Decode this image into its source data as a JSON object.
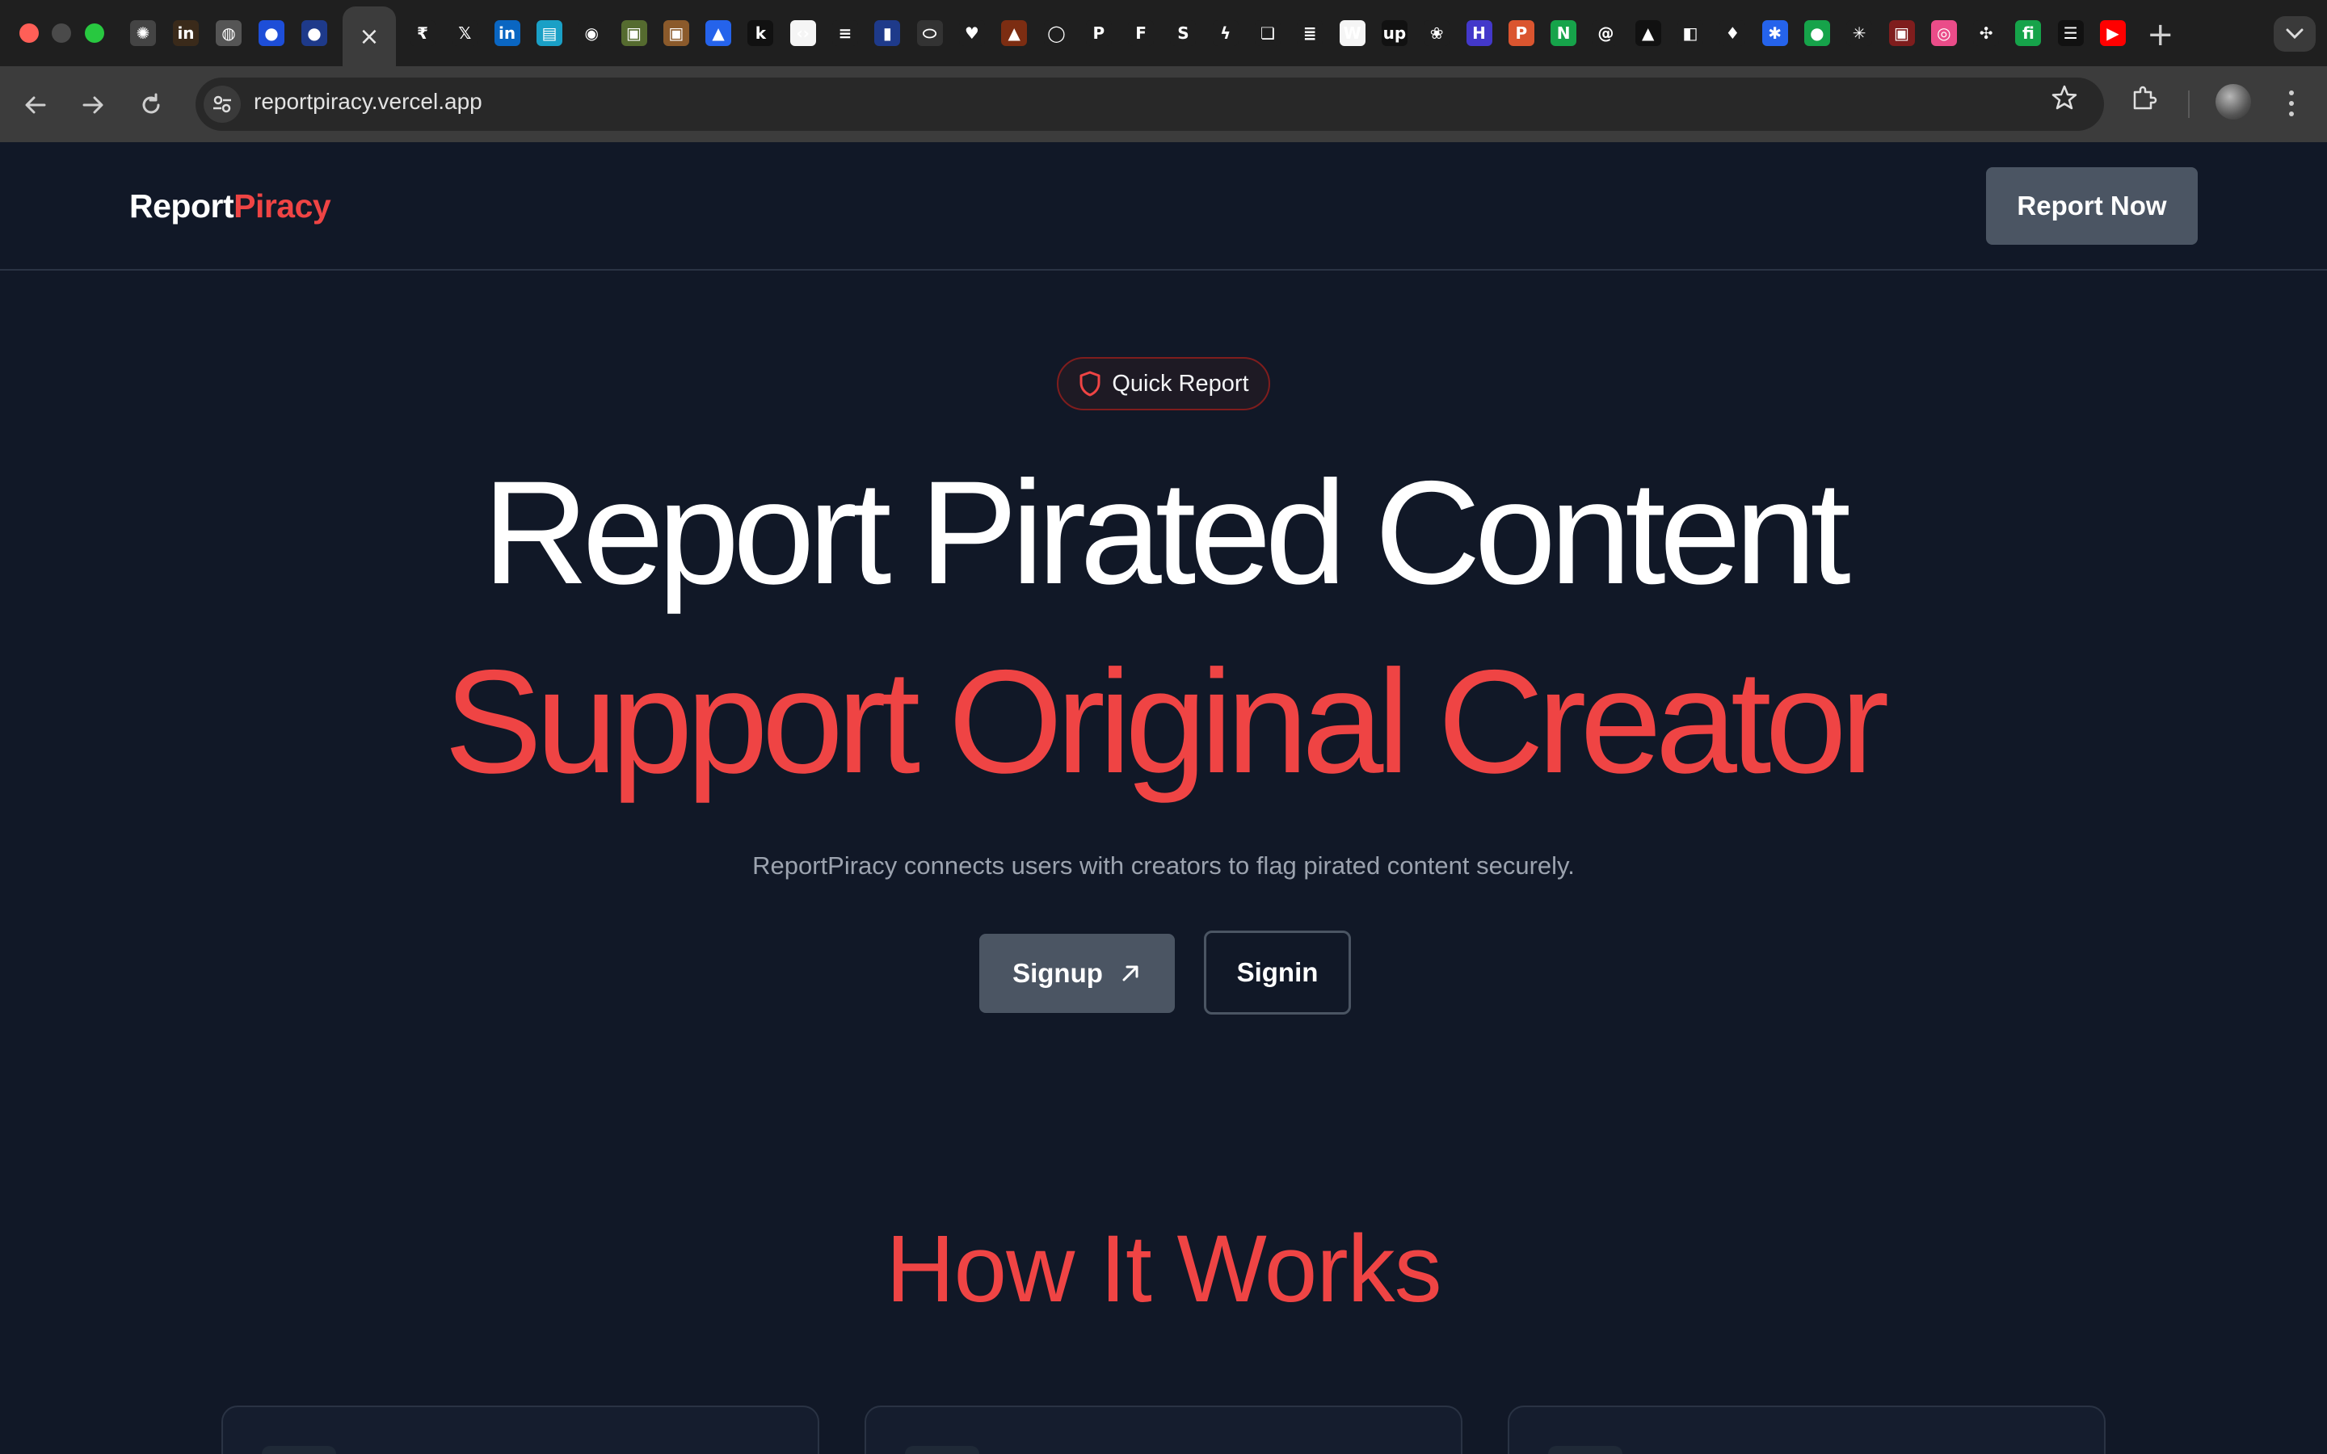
{
  "browser": {
    "active_tab_close": "×",
    "new_tab": "+",
    "url": "reportpiracy.vercel.app",
    "tab_favicons": [
      {
        "icon": "openai-icon",
        "glyph": "✺",
        "color": "#444"
      },
      {
        "icon": "invision-icon",
        "glyph": "in",
        "color": "#3a2a1a"
      },
      {
        "icon": "globe-icon",
        "glyph": "◍",
        "color": "#555"
      },
      {
        "icon": "profile-icon",
        "glyph": "●",
        "color": "#1d4ed8"
      },
      {
        "icon": "profile-icon",
        "glyph": "●",
        "color": "#1e3a8a"
      },
      {
        "icon": "rupee-icon",
        "glyph": "₹",
        "color": "#1f1f1f"
      },
      {
        "icon": "x-icon",
        "glyph": "𝕏",
        "color": "#1f1f1f"
      },
      {
        "icon": "linkedin-icon",
        "glyph": "in",
        "color": "#0a66c2"
      },
      {
        "icon": "doc-icon",
        "glyph": "▤",
        "color": "#1aa0c6"
      },
      {
        "icon": "github-icon",
        "glyph": "◉",
        "color": "#1f1f1f"
      },
      {
        "icon": "photo-icon",
        "glyph": "▣",
        "color": "#556b2f"
      },
      {
        "icon": "photo-icon",
        "glyph": "▣",
        "color": "#8b5a2b"
      },
      {
        "icon": "arc-icon",
        "glyph": "▲",
        "color": "#2563eb"
      },
      {
        "icon": "k-icon",
        "glyph": "k",
        "color": "#111"
      },
      {
        "icon": "code-icon",
        "glyph": "‹›",
        "color": "#f5f5f5"
      },
      {
        "icon": "lines-icon",
        "glyph": "≡",
        "color": "#1f1f1f"
      },
      {
        "icon": "bookmark-icon",
        "glyph": "▮",
        "color": "#1e3a8a"
      },
      {
        "icon": "pill-icon",
        "glyph": "⬭",
        "color": "#333"
      },
      {
        "icon": "heart-icon",
        "glyph": "♥",
        "color": "#1f1f1f"
      },
      {
        "icon": "person-icon",
        "glyph": "▲",
        "color": "#7c2d12"
      },
      {
        "icon": "circle-icon",
        "glyph": "◯",
        "color": "#1f1f1f"
      },
      {
        "icon": "p-icon",
        "glyph": "P",
        "color": "#1f1f1f"
      },
      {
        "icon": "f-icon",
        "glyph": "F",
        "color": "#1f1f1f"
      },
      {
        "icon": "s-icon",
        "glyph": "S",
        "color": "#1f1f1f"
      },
      {
        "icon": "bolt-icon",
        "glyph": "ϟ",
        "color": "#1f1f1f"
      },
      {
        "icon": "chat-icon",
        "glyph": "❏",
        "color": "#1f1f1f"
      },
      {
        "icon": "stack-icon",
        "glyph": "≣",
        "color": "#1f1f1f"
      },
      {
        "icon": "w-icon",
        "glyph": "W",
        "color": "#f5f5f5"
      },
      {
        "icon": "upwork-icon",
        "glyph": "up",
        "color": "#111"
      },
      {
        "icon": "leaf-icon",
        "glyph": "❀",
        "color": "#1f1f1f"
      },
      {
        "icon": "h-icon",
        "glyph": "H",
        "color": "#4338ca"
      },
      {
        "icon": "producthunt-icon",
        "glyph": "P",
        "color": "#da552f"
      },
      {
        "icon": "n-icon",
        "glyph": "N",
        "color": "#16a34a"
      },
      {
        "icon": "swirl-icon",
        "glyph": "@",
        "color": "#1f1f1f"
      },
      {
        "icon": "triangle-icon",
        "glyph": "▲",
        "color": "#111"
      },
      {
        "icon": "shape-icon",
        "glyph": "◧",
        "color": "#1f1f1f"
      },
      {
        "icon": "leaf-icon",
        "glyph": "♦",
        "color": "#1f1f1f"
      },
      {
        "icon": "puzzle-icon",
        "glyph": "✱",
        "color": "#2563eb"
      },
      {
        "icon": "mushroom-icon",
        "glyph": "●",
        "color": "#16a34a"
      },
      {
        "icon": "asterisk-icon",
        "glyph": "✳",
        "color": "#1f1f1f"
      },
      {
        "icon": "photo-icon",
        "glyph": "▣",
        "color": "#7f1d1d"
      },
      {
        "icon": "dribbble-icon",
        "glyph": "◎",
        "color": "#ea4c89"
      },
      {
        "icon": "grid-icon",
        "glyph": "✣",
        "color": "#1f1f1f"
      },
      {
        "icon": "fh-icon",
        "glyph": "fi",
        "color": "#16a34a"
      },
      {
        "icon": "lines-icon",
        "glyph": "☰",
        "color": "#111"
      },
      {
        "icon": "youtube-icon",
        "glyph": "▶",
        "color": "#ff0000"
      }
    ]
  },
  "header": {
    "logo_part1": "Report",
    "logo_part2": "Piracy",
    "cta_label": "Report Now"
  },
  "hero": {
    "badge_label": "Quick Report",
    "title_line1": "Report Pirated Content",
    "title_line2": "Support Original Creator",
    "subtitle": "ReportPiracy connects users with creators to flag pirated content securely.",
    "signup_label": "Signup",
    "signin_label": "Signin"
  },
  "how_it_works": {
    "heading": "How It Works",
    "cards": [
      {},
      {},
      {}
    ]
  },
  "colors": {
    "page_bg": "#111827",
    "accent_red": "#ef4444",
    "button_gray": "#4b5563",
    "muted_text": "#9ca3af"
  }
}
